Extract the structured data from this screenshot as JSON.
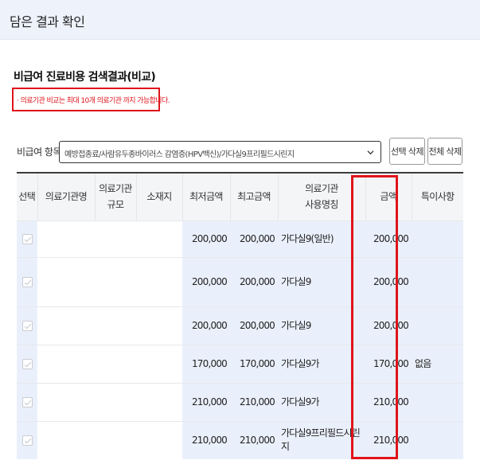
{
  "page": {
    "title": "담은 결과 확인"
  },
  "section": {
    "title": "비급여 진료비용 검색결과(비교)",
    "notice": "· 의료기관 비교는 최대 10개 의료기관 까지 가능합니다."
  },
  "filter": {
    "label": "비급여 항목",
    "selected": "예방접종료/사람유두종바이러스 감염증(HPV백신)/가다실9프리필드시린지",
    "btn_delete_selected": "선택 삭제",
    "btn_delete_all": "전체 삭제"
  },
  "table": {
    "headers": {
      "select": "선택",
      "hospital": "의료기관명",
      "scale_1": "의료기관",
      "scale_2": "규모",
      "location": "소재지",
      "min": "최저금액",
      "max": "최고금액",
      "usename_1": "의료기관",
      "usename_2": "사용명칭",
      "amount": "금액",
      "notes": "특이사항"
    },
    "rows": [
      {
        "min": "200,000",
        "max": "200,000",
        "name": "가다실9(일반)",
        "amount": "200,000",
        "note": ""
      },
      {
        "min": "200,000",
        "max": "200,000",
        "name": "가다실9",
        "amount": "200,000",
        "note": ""
      },
      {
        "min": "200,000",
        "max": "200,000",
        "name": "가다실9",
        "amount": "200,000",
        "note": ""
      },
      {
        "min": "170,000",
        "max": "170,000",
        "name": "가다실9가",
        "amount": "170,000",
        "note": "없음"
      },
      {
        "min": "210,000",
        "max": "210,000",
        "name": "가다실9가",
        "amount": "210,000",
        "note": ""
      },
      {
        "min": "210,000",
        "max": "210,000",
        "name": "가다실9프리필드시린지",
        "amount": "210,000",
        "note": ""
      }
    ]
  },
  "colors": {
    "highlight": "#e0141b",
    "row_blue": "#eaf0fb",
    "header_bg": "#eef2fb"
  }
}
